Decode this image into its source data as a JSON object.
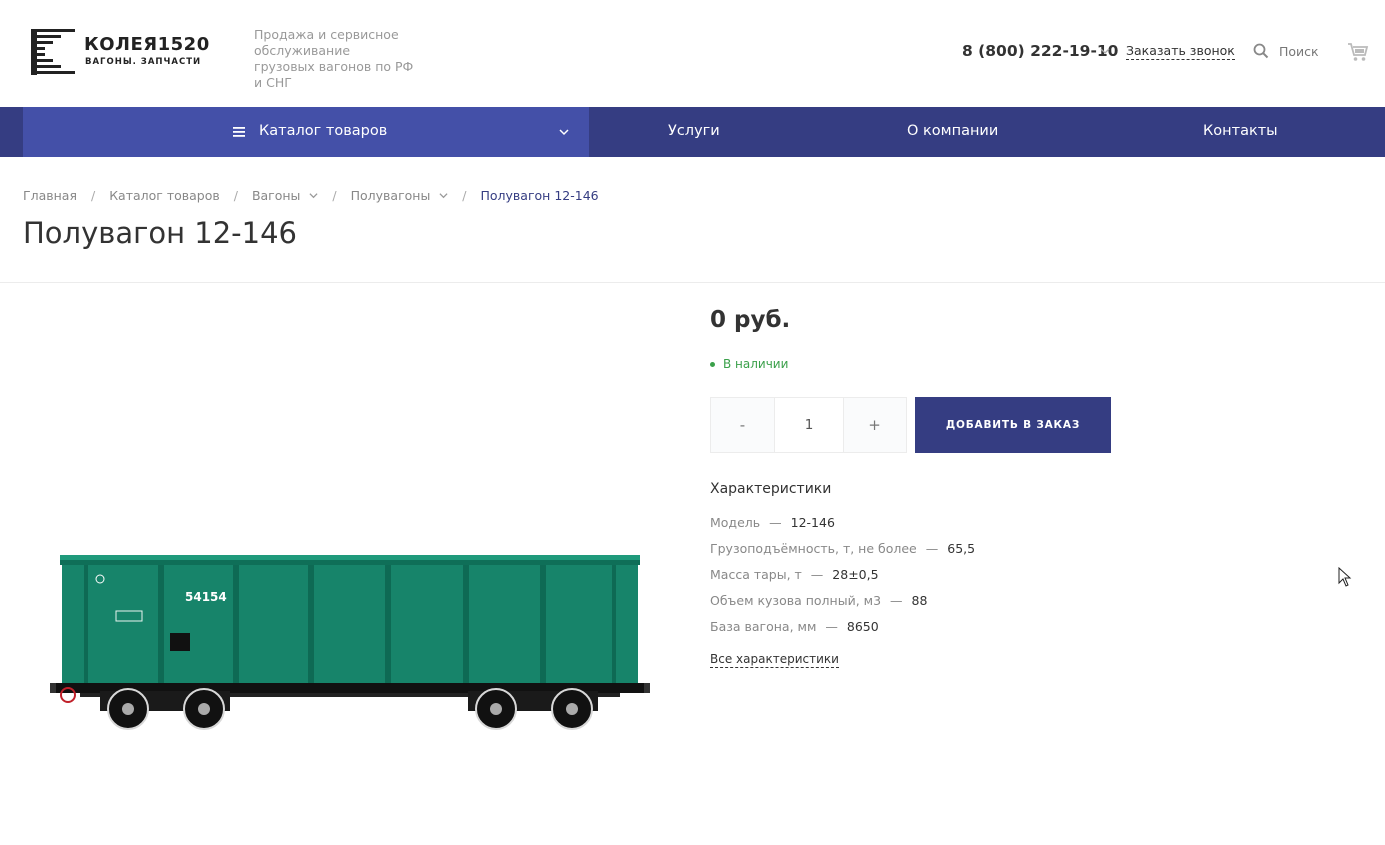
{
  "header": {
    "logo_name": "КОЛЕЯ1520",
    "logo_sub": "ВАГОНЫ. ЗАПЧАСТИ",
    "tagline": "Продажа и сервисное обслуживание грузовых вагонов по РФ и СНГ",
    "phone": "8 (800) 222-19-10",
    "callback_label": "Заказать звонок",
    "search_label": "Поиск"
  },
  "nav": {
    "catalog_label": "Каталог товаров",
    "items": [
      "Услуги",
      "О компании",
      "Контакты"
    ]
  },
  "breadcrumb": {
    "items": [
      "Главная",
      "Каталог товаров",
      "Вагоны",
      "Полувагоны"
    ],
    "current": "Полувагон 12-146"
  },
  "product": {
    "title": "Полувагон 12-146",
    "car_number": "54154",
    "price": "0 руб.",
    "stock": "В наличии",
    "qty_minus": "-",
    "qty_value": "1",
    "qty_plus": "+",
    "order_button": "ДОБАВИТЬ В ЗАКАЗ",
    "characteristics_title": "Характеристики",
    "characteristics": [
      {
        "name": "Модель",
        "value": "12-146"
      },
      {
        "name": "Грузоподъёмность, т, не более",
        "value": "65,5"
      },
      {
        "name": "Масса тары, т",
        "value": "28±0,5"
      },
      {
        "name": "Объем кузова полный, м3",
        "value": "88"
      },
      {
        "name": "База вагона, мм",
        "value": "8650"
      }
    ],
    "all_characteristics": "Все характеристики",
    "separator": "—"
  },
  "colors": {
    "nav_bg": "#353d82",
    "nav_catalog_bg": "#4450a8",
    "accent": "#353d82",
    "stock_green": "#3aa04a",
    "wagon_green": "#17846a"
  }
}
